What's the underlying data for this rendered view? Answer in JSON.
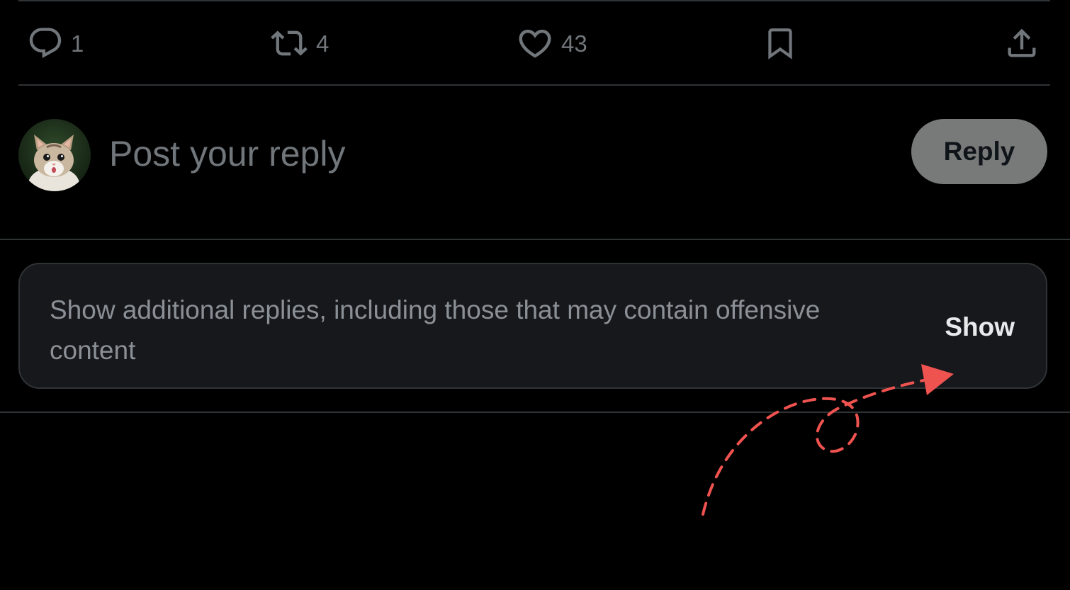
{
  "actions": {
    "reply": {
      "icon": "comment-icon",
      "count": "1"
    },
    "repost": {
      "icon": "repost-icon",
      "count": "4"
    },
    "like": {
      "icon": "heart-icon",
      "count": "43"
    },
    "bookmark": {
      "icon": "bookmark-icon"
    },
    "share": {
      "icon": "share-upload-icon"
    }
  },
  "composer": {
    "avatar": "cat-avatar",
    "placeholder": "Post your reply",
    "reply_button_label": "Reply"
  },
  "notice": {
    "text": "Show additional replies, including those that may contain offensive content",
    "show_label": "Show"
  },
  "colors": {
    "background": "#000000",
    "muted_text": "#71767b",
    "divider": "#2f3336",
    "reply_button_bg": "#787a7a",
    "notice_bg": "#16181c",
    "annotation_arrow": "#ef5350"
  },
  "annotation": {
    "icon": "dashed-curved-arrow"
  }
}
